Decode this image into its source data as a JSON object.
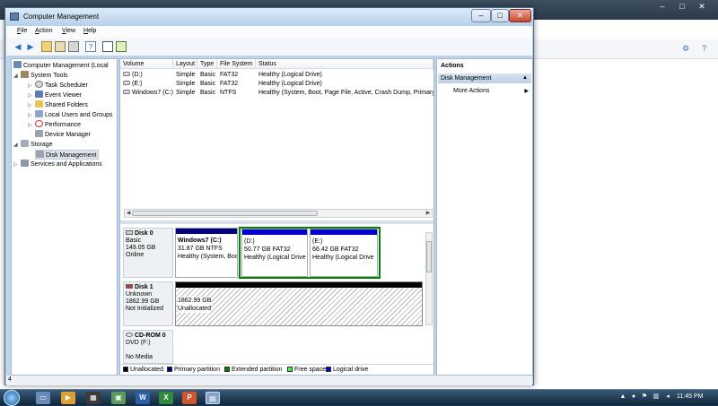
{
  "window": {
    "title": "Computer Management"
  },
  "menu": [
    "File",
    "Action",
    "View",
    "Help"
  ],
  "menu_underline": [
    "F",
    "A",
    "V",
    "H"
  ],
  "tree": {
    "root": "Computer Management (Local",
    "system_tools": "System Tools",
    "task_scheduler": "Task Scheduler",
    "event_viewer": "Event Viewer",
    "shared_folders": "Shared Folders",
    "local_users": "Local Users and Groups",
    "performance": "Performance",
    "device_manager": "Device Manager",
    "storage": "Storage",
    "disk_management": "Disk Management",
    "services": "Services and Applications"
  },
  "volume_table": {
    "headers": [
      "Volume",
      "Layout",
      "Type",
      "File System",
      "Status"
    ],
    "rows": [
      [
        "(D:)",
        "Simple",
        "Basic",
        "FAT32",
        "Healthy (Logical Drive)"
      ],
      [
        "(E:)",
        "Simple",
        "Basic",
        "FAT32",
        "Healthy (Logical Drive)"
      ],
      [
        "Windows7 (C:)",
        "Simple",
        "Basic",
        "NTFS",
        "Healthy (System, Boot, Page File, Active, Crash Dump, Primary"
      ]
    ]
  },
  "disks": {
    "disk0": {
      "name": "Disk 0",
      "type": "Basic",
      "size": "149.05 GB",
      "state": "Online",
      "partitions": [
        {
          "name": "Windows7  (C:)",
          "size": "31.87 GB NTFS",
          "status": "Healthy (System, Boo"
        },
        {
          "name": "(D:)",
          "size": "50.77 GB FAT32",
          "status": "Healthy (Logical Drive"
        },
        {
          "name": "(E:)",
          "size": "66.42 GB FAT32",
          "status": "Healthy (Logical Drive"
        }
      ]
    },
    "disk1": {
      "name": "Disk 1",
      "type": "Unknown",
      "size": "1862.99 GB",
      "state": "Not Initialized",
      "unalloc_size": "1862.99 GB",
      "unalloc_label": "Unallocated"
    },
    "cdrom": {
      "name": "CD-ROM 0",
      "type": "DVD (F:)",
      "state": "No Media"
    }
  },
  "legend": [
    "Unallocated",
    "Primary partition",
    "Extended partition",
    "Free space",
    "Logical drive"
  ],
  "colors": {
    "unallocated": "#000000",
    "primary": "#000080",
    "extended": "#008000",
    "free": "#33ff33",
    "logical": "#0000cc"
  },
  "actions": {
    "title": "Actions",
    "section": "Disk Management",
    "more": "More Actions"
  },
  "status_left": "4",
  "taskbar": {
    "clock": "11:45 PM"
  }
}
